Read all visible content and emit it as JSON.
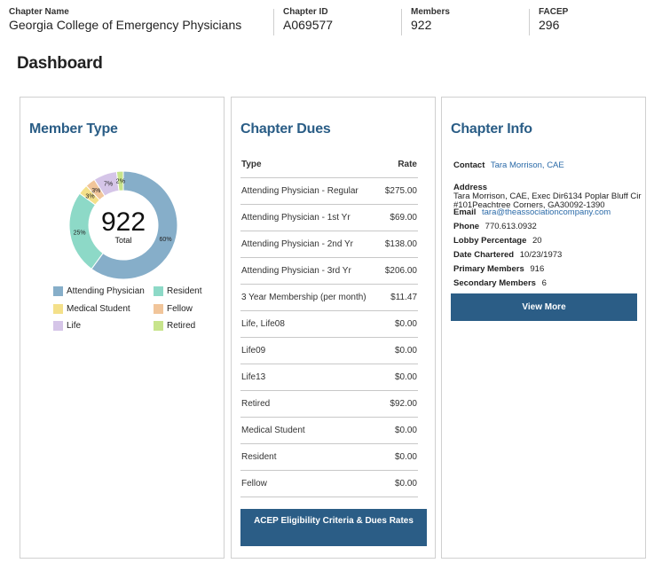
{
  "header": {
    "chapter_name": {
      "label": "Chapter Name",
      "value": "Georgia College of Emergency Physicians"
    },
    "chapter_id": {
      "label": "Chapter ID",
      "value": "A069577"
    },
    "members": {
      "label": "Members",
      "value": "922"
    },
    "facep": {
      "label": "FACEP",
      "value": "296"
    }
  },
  "page_title": "Dashboard",
  "member_type": {
    "title": "Member Type",
    "total_value": "922",
    "total_label": "Total",
    "chart_data": {
      "type": "pie",
      "series": [
        {
          "name": "Attending Physician",
          "value": 60,
          "label": "60%",
          "color": "#86aec9"
        },
        {
          "name": "Resident",
          "value": 25,
          "label": "25%",
          "color": "#8dd9c7"
        },
        {
          "name": "Medical Student",
          "value": 3,
          "label": "3%",
          "color": "#f4e08a"
        },
        {
          "name": "Fellow",
          "value": 3,
          "label": "3%",
          "color": "#f1c59a"
        },
        {
          "name": "Life",
          "value": 7,
          "label": "7%",
          "color": "#d5c5e8"
        },
        {
          "name": "Retired",
          "value": 2,
          "label": "2%",
          "color": "#c7e48b"
        }
      ],
      "legend_placement": "bottom"
    },
    "legend": [
      {
        "label": "Attending Physician",
        "color": "#86aec9"
      },
      {
        "label": "Resident",
        "color": "#8dd9c7"
      },
      {
        "label": "Medical Student",
        "color": "#f4e08a"
      },
      {
        "label": "Fellow",
        "color": "#f1c59a"
      },
      {
        "label": "Life",
        "color": "#d5c5e8"
      },
      {
        "label": "Retired",
        "color": "#c7e48b"
      }
    ]
  },
  "chapter_dues": {
    "title": "Chapter Dues",
    "col_type": "Type",
    "col_rate": "Rate",
    "rows": [
      {
        "type": "Attending Physician - Regular",
        "rate": "$275.00"
      },
      {
        "type": "Attending Physician - 1st Yr",
        "rate": "$69.00"
      },
      {
        "type": "Attending Physician - 2nd Yr",
        "rate": "$138.00"
      },
      {
        "type": "Attending Physician - 3rd Yr",
        "rate": "$206.00"
      },
      {
        "type": "3 Year Membership (per month)",
        "rate": "$11.47"
      },
      {
        "type": "Life, Life08",
        "rate": "$0.00"
      },
      {
        "type": "Life09",
        "rate": "$0.00"
      },
      {
        "type": "Life13",
        "rate": "$0.00"
      },
      {
        "type": "Retired",
        "rate": "$92.00"
      },
      {
        "type": "Medical Student",
        "rate": "$0.00"
      },
      {
        "type": "Resident",
        "rate": "$0.00"
      },
      {
        "type": "Fellow",
        "rate": "$0.00"
      }
    ],
    "button_label": "ACEP Eligibility Criteria & Dues Rates"
  },
  "chapter_info": {
    "title": "Chapter Info",
    "contact_label": "Contact",
    "contact_value": "Tara Morrison, CAE",
    "address_label": "Address",
    "address_line1": "Tara Morrison, CAE, Exec Dir6134 Poplar Bluff Cir",
    "address_line2": "#101Peachtree Corners, GA30092-1390",
    "email_label": "Email",
    "email_value": "tara@theassociationcompany.com",
    "phone_label": "Phone",
    "phone_value": "770.613.0932",
    "lobby_label": "Lobby Percentage",
    "lobby_value": "20",
    "chartered_label": "Date Chartered",
    "chartered_value": "10/23/1973",
    "primary_label": "Primary Members",
    "primary_value": "916",
    "secondary_label": "Secondary Members",
    "secondary_value": "6",
    "button_label": "View More"
  }
}
